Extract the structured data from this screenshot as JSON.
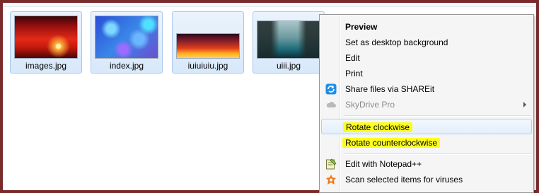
{
  "files": [
    {
      "name": "images.jpg"
    },
    {
      "name": "index.jpg"
    },
    {
      "name": "iuiuiuiu.jpg"
    },
    {
      "name": "uiii.jpg"
    }
  ],
  "context_menu": {
    "preview": "Preview",
    "set_desktop_background": "Set as desktop background",
    "edit": "Edit",
    "print": "Print",
    "shareit": {
      "label": "Share files via SHAREit",
      "icon": "shareit-icon"
    },
    "skydrive": {
      "label": "SkyDrive Pro",
      "icon": "cloud-icon"
    },
    "rotate_clockwise": "Rotate clockwise",
    "rotate_counterclockwise": "Rotate counterclockwise",
    "notepad": {
      "label": "Edit with Notepad++",
      "icon": "notepadpp-icon"
    },
    "scan": {
      "label": "Scan selected items for viruses",
      "icon": "avast-icon"
    }
  },
  "colors": {
    "frame": "#7a2a2a",
    "highlight": "#fdfd22",
    "selection_border": "#a9c8ec"
  }
}
